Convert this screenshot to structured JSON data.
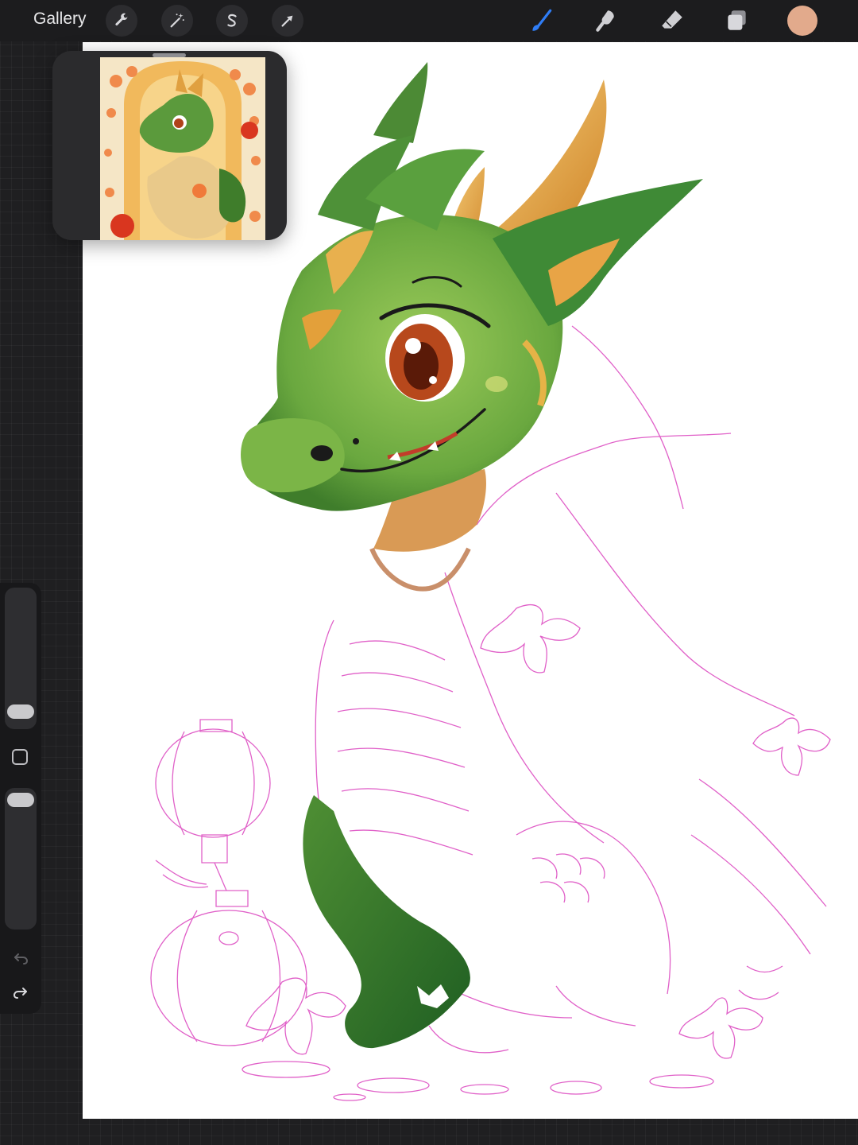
{
  "topbar": {
    "gallery_label": "Gallery",
    "left_tools": [
      "wrench-icon",
      "magic-wand-icon",
      "selection-s-icon",
      "transform-arrow-icon"
    ],
    "right_tools": [
      "brush-icon",
      "smudge-icon",
      "eraser-icon",
      "layers-icon"
    ],
    "active_tool": "brush-icon",
    "active_tool_color": "#2f7df6",
    "current_color": "#e2aa8c"
  },
  "sidebar": {
    "brush_size_level": 0.05,
    "opacity_level": 1.0,
    "modify_button": "square-icon",
    "undo": "undo-icon",
    "redo": "redo-icon"
  },
  "canvas": {
    "background": "#ffffff",
    "sketch_line_color": "#e060c8",
    "dragon_green": "#5fa23a",
    "horn_gold": "#e3a03a"
  },
  "reference": {
    "frame_color": "#2b2b2d"
  }
}
